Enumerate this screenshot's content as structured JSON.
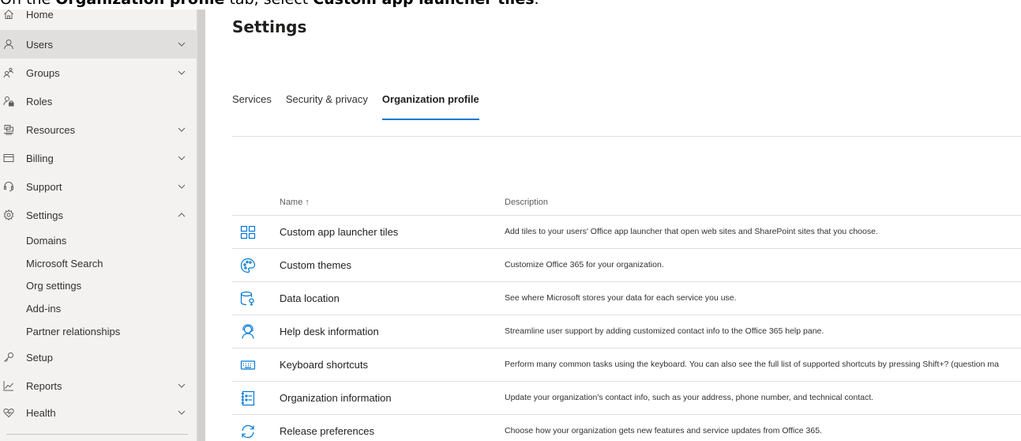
{
  "instruction": {
    "prefix": "On the ",
    "tab_name": "Organization profile",
    "middle": " tab, select ",
    "target": "Custom app launcher tiles",
    "suffix": "."
  },
  "sidebar": {
    "items": [
      {
        "label": "Home",
        "icon": "home-icon"
      },
      {
        "label": "Users",
        "icon": "user-icon",
        "expanded": false
      },
      {
        "label": "Groups",
        "icon": "groups-icon",
        "expanded": false
      },
      {
        "label": "Roles",
        "icon": "roles-icon"
      },
      {
        "label": "Resources",
        "icon": "resources-icon",
        "expanded": false
      },
      {
        "label": "Billing",
        "icon": "billing-icon",
        "expanded": false
      },
      {
        "label": "Support",
        "icon": "headset-icon",
        "expanded": false
      },
      {
        "label": "Settings",
        "icon": "gear-icon",
        "expanded": true
      },
      {
        "label": "Setup",
        "icon": "key-icon"
      },
      {
        "label": "Reports",
        "icon": "chart-icon",
        "expanded": false
      },
      {
        "label": "Health",
        "icon": "heart-icon",
        "expanded": false
      }
    ],
    "settings_subitems": [
      "Domains",
      "Microsoft Search",
      "Org settings",
      "Add-ins",
      "Partner relationships"
    ]
  },
  "main": {
    "title": "Settings",
    "tabs": [
      "Services",
      "Security & privacy",
      "Organization profile"
    ],
    "active_tab": "Organization profile",
    "columns": {
      "name": "Name ↑",
      "description": "Description"
    },
    "rows": [
      {
        "name": "Custom app launcher tiles",
        "icon": "tiles-icon",
        "description": "Add tiles to your users' Office app launcher that open web sites and SharePoint sites that you choose."
      },
      {
        "name": "Custom themes",
        "icon": "palette-icon",
        "description": "Customize Office 365 for your organization."
      },
      {
        "name": "Data location",
        "icon": "database-icon",
        "description": "See where Microsoft stores your data for each service you use."
      },
      {
        "name": "Help desk information",
        "icon": "helpdesk-icon",
        "description": "Streamline user support by adding customized contact info to the Office 365 help pane."
      },
      {
        "name": "Keyboard shortcuts",
        "icon": "keyboard-icon",
        "description": "Perform many common tasks using the keyboard. You can also see the full list of supported shortcuts by pressing Shift+? (question ma"
      },
      {
        "name": "Organization information",
        "icon": "org-info-icon",
        "description": "Update your organization's contact info, such as your address, phone number, and technical contact."
      },
      {
        "name": "Release preferences",
        "icon": "refresh-icon",
        "description": "Choose how your organization gets new features and service updates from Office 365."
      }
    ]
  },
  "colors": {
    "accent": "#0078d4",
    "sidebar_bg": "#f3f2f1",
    "sidebar_active": "#e1dfdd"
  }
}
